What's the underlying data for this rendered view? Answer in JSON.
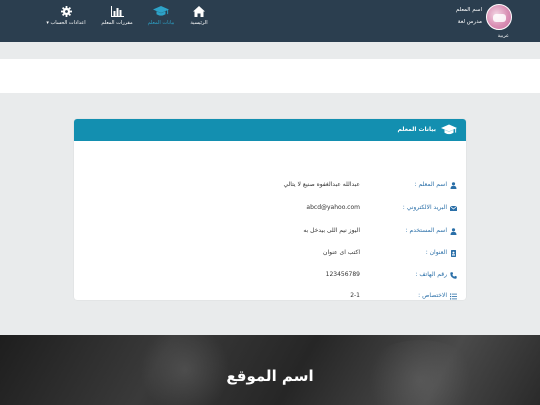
{
  "profile": {
    "name": "اسم المعلم",
    "role": "مدرس لغة",
    "subject": "عربية"
  },
  "nav": {
    "home": "الرئيسية",
    "teacher_data": "بيانات المعلم",
    "teacher_courses": "مقررات المعلم",
    "account_settings": "اعدادات الحساب"
  },
  "card": {
    "title": "بيانات المعلم",
    "rows": [
      {
        "label": "اسم المعلم :",
        "value": "عبدالله عبدالغفوه صنيع لا يتالي",
        "icon": "user-icon"
      },
      {
        "label": "البريد الالكتروني :",
        "value": "abcd@yahoo.com",
        "icon": "envelope-icon"
      },
      {
        "label": "اسم المستخدم :",
        "value": "اليوز نيم اللى بيدخل به",
        "icon": "user-icon"
      },
      {
        "label": "العنوان :",
        "value": "اكتب اى عنوان",
        "icon": "address-card-icon"
      },
      {
        "label": "رقم الهاتف :",
        "value": "123456789",
        "icon": "phone-icon"
      },
      {
        "label": "الاختصاص :",
        "value": "2-1",
        "icon": "list-icon"
      }
    ]
  },
  "footer": {
    "site_name": "اسم الموقع"
  },
  "colors": {
    "navbar": "#2b3e4f",
    "accent": "#138fb0",
    "nav_active": "#2da3c9",
    "label": "#2a6fa8"
  }
}
